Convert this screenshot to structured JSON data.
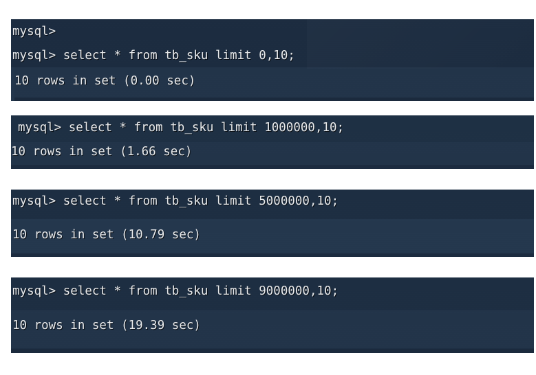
{
  "page": {
    "title": "MySQL LIMIT offset performance comparison",
    "background_color": "#ffffff",
    "terminal_background_color": "#1d2e42",
    "terminal_text_color": "#e9ebed"
  },
  "blocks": [
    {
      "id": "block-1",
      "name": "mysql-console-block-offset-0",
      "lines": [
        "mysql>",
        "mysql> select * from tb_sku limit 0,10;",
        "10 rows in set (0.00 sec)"
      ],
      "query": "select * from tb_sku limit 0,10;",
      "offset": "0",
      "row_count": "10",
      "elapsed_seconds": "0.00",
      "result_text": "10 rows in set (0.00 sec)"
    },
    {
      "id": "block-2",
      "name": "mysql-console-block-offset-1000000",
      "lines": [
        "mysql> select * from tb_sku limit 1000000,10;",
        "10 rows in set (1.66 sec)"
      ],
      "query": "select * from tb_sku limit 1000000,10;",
      "offset": "1000000",
      "row_count": "10",
      "elapsed_seconds": "1.66",
      "result_text": "10 rows in set (1.66 sec)"
    },
    {
      "id": "block-3",
      "name": "mysql-console-block-offset-5000000",
      "lines": [
        "mysql> select * from tb_sku limit 5000000,10;",
        "10 rows in set (10.79 sec)"
      ],
      "query": "select * from tb_sku limit 5000000,10;",
      "offset": "5000000",
      "row_count": "10",
      "elapsed_seconds": "10.79",
      "result_text": "10 rows in set (10.79 sec)"
    },
    {
      "id": "block-4",
      "name": "mysql-console-block-offset-9000000",
      "lines": [
        "mysql> select * from tb_sku limit 9000000,10;",
        "10 rows in set (19.39 sec)"
      ],
      "query": "select * from tb_sku limit 9000000,10;",
      "offset": "9000000",
      "row_count": "10",
      "elapsed_seconds": "19.39",
      "result_text": "10 rows in set (19.39 sec)"
    }
  ]
}
